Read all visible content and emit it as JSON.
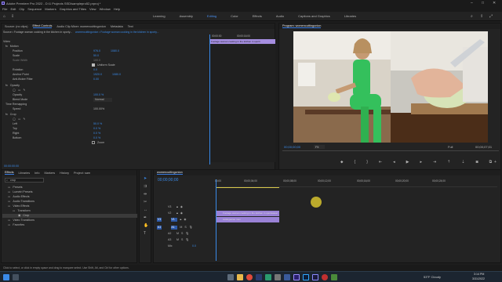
{
  "titlebar": {
    "title": "Adobe Premiere Pro 2022 - D:\\1 Projects SSD\\samplepro52.prproj *"
  },
  "menu": [
    "File",
    "Edit",
    "Clip",
    "Sequence",
    "Markers",
    "Graphics and Titles",
    "View",
    "Window",
    "Help"
  ],
  "workspaces": [
    "Learning",
    "Assembly",
    "Editing",
    "Color",
    "Effects",
    "Audio",
    "Captions and Graphics",
    "Libraries"
  ],
  "active_workspace": "Editing",
  "effect_controls": {
    "tabs": [
      "Source: (no clips)",
      "Effect Controls",
      "Audio Clip Mixer: womencuttingonion",
      "Metadata",
      "Text"
    ],
    "source_label": "Source • Footage woman cooking in the kitchen in sporty...",
    "clip_label": "womencuttingonion • Footage woman cooking in the kitchen in sporty...",
    "timecode_start": "00:00:00",
    "timecode_end": "00:00:16:00",
    "clip_bar": "Footage woman cooking in the kitchen in sporti",
    "section_video": "Video",
    "motion": "Motion",
    "position": {
      "label": "Position",
      "x": "976.0",
      "y": "1080.0"
    },
    "scale": {
      "label": "Scale",
      "value": "50.0"
    },
    "scale_width": {
      "label": "Scale Width",
      "value": "100.0"
    },
    "uniform_scale": "Uniform Scale",
    "rotation": {
      "label": "Rotation",
      "value": "0.0"
    },
    "anchor_point": {
      "label": "Anchor Point",
      "x": "1920.0",
      "y": "1080.0"
    },
    "anti_flicker": {
      "label": "Anti-flicker Filter",
      "value": "0.00"
    },
    "opacity_section": "Opacity",
    "opacity": {
      "label": "Opacity",
      "value": "100.0 %"
    },
    "blend_mode": {
      "label": "Blend Mode",
      "value": "Normal"
    },
    "time_remap": "Time Remapping",
    "speed": {
      "label": "Speed",
      "value": "100.00%"
    },
    "crop": "Crop",
    "left": {
      "label": "Left",
      "value": "50.0 %"
    },
    "top": {
      "label": "Top",
      "value": "0.0 %"
    },
    "right": {
      "label": "Right",
      "value": "0.0 %"
    },
    "bottom": {
      "label": "Bottom",
      "value": "0.0 %"
    },
    "zoom": "Zoom",
    "footer_time": "00:00:00:00"
  },
  "program": {
    "title": "Program: womencuttingonion",
    "timecode": "00;00;00;00",
    "fit": "Fit",
    "quality": "Full",
    "duration": "00;00;07;01"
  },
  "effects_panel": {
    "tabs": [
      "Effects",
      "Libraries",
      "Info",
      "Markers",
      "History",
      "Project: sam"
    ],
    "search": "crop",
    "tree": [
      "Presets",
      "Lumetri Presets",
      "Audio Effects",
      "Audio Transitions",
      "Video Effects",
      "Transform",
      "Crop",
      "Video Transitions",
      "Favorites"
    ]
  },
  "timeline": {
    "tab": "womencuttingonion",
    "timecode": "00;00;00;00",
    "ruler": [
      "00;00",
      "00;00;04;00",
      "00;00;08;00",
      "00;00;12;00",
      "00;00;16;00",
      "00;00;20;00",
      "00;00;24;00"
    ],
    "tracks_video": [
      "V3",
      "V2",
      "V1"
    ],
    "tracks_audio": [
      "A1",
      "A2",
      "A3"
    ],
    "master": "Mix",
    "master_value": "0.0",
    "clip_v2": "Footage woman cooking in the kitchen in sportswear",
    "clip_v1": "cuttingonion.mov"
  },
  "status": "Click to select, or click in empty space and drag to marquee select. Use Shift, Alt, and Ctrl for other options.",
  "taskbar": {
    "weather": "53°F Cloudy",
    "time": "3:14 PM",
    "date": "3/31/2022"
  },
  "colors": {
    "accent": "#3a8ae8",
    "clip_purple": "#a58ee0"
  }
}
